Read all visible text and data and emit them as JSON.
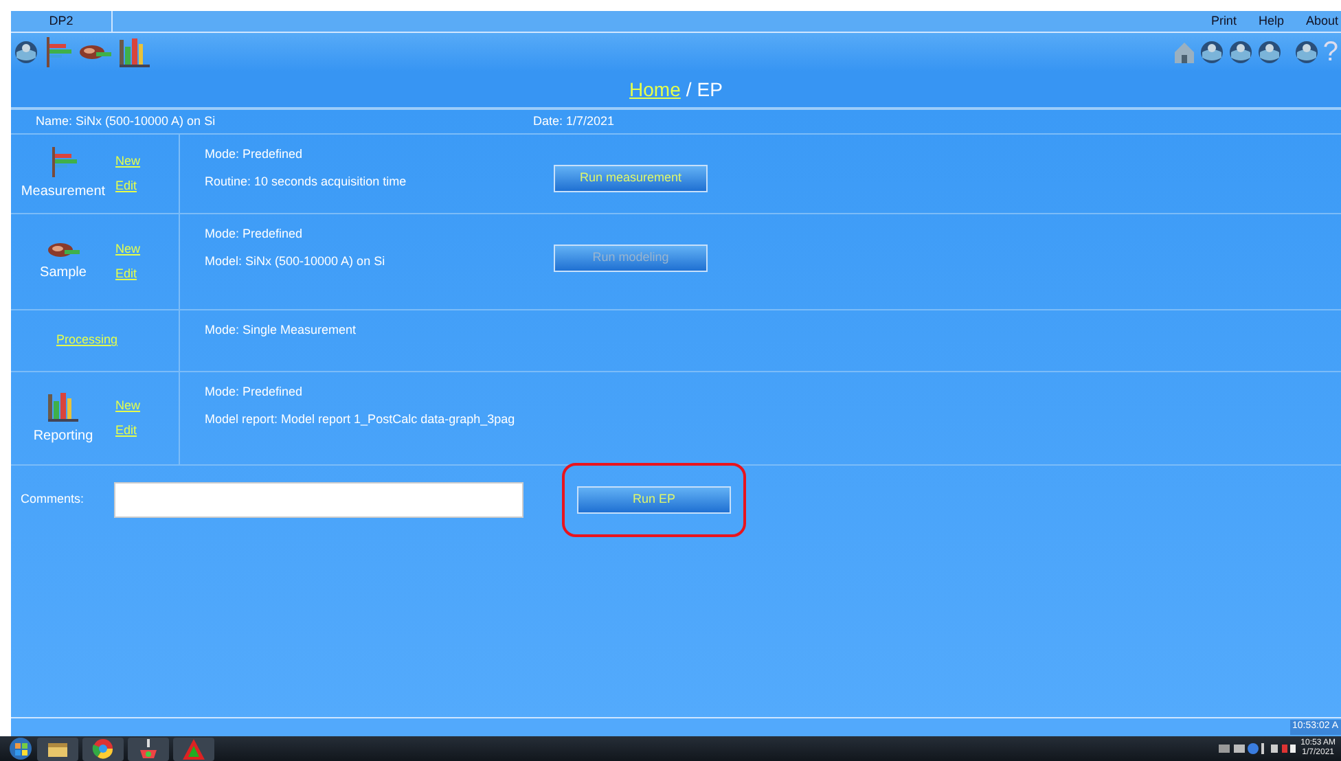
{
  "title_bar": {
    "title": "DP2",
    "menu": [
      "Print",
      "Help",
      "About"
    ]
  },
  "toolbar": {
    "help_glyph": "?"
  },
  "breadcrumb": {
    "link": "Home",
    "separator": "/",
    "current": "EP"
  },
  "header": {
    "name": "Name: SiNx (500-10000 A) on Si",
    "date": "Date: 1/7/2021"
  },
  "sections": [
    {
      "kind": "icon",
      "label": "Measurement",
      "links": [
        "New",
        "Edit"
      ],
      "lines": [
        "Mode: Predefined",
        "Routine: 10 seconds acquisition time"
      ],
      "button": {
        "label": "Run measurement",
        "disabled": false
      }
    },
    {
      "kind": "icon",
      "label": "Sample",
      "links": [
        "New",
        "Edit"
      ],
      "lines": [
        "Mode: Predefined",
        "Model: SiNx (500-10000 A) on Si"
      ],
      "button": {
        "label": "Run modeling",
        "disabled": true
      }
    },
    {
      "kind": "link",
      "label": "Processing",
      "lines": [
        "Mode: Single Measurement"
      ]
    },
    {
      "kind": "icon",
      "label": "Reporting",
      "links": [
        "New",
        "Edit"
      ],
      "lines": [
        "Mode: Predefined",
        "Model report: Model report 1_PostCalc data-graph_3pag"
      ]
    }
  ],
  "comments": {
    "label": "Comments:"
  },
  "run_button": {
    "label": "Run EP",
    "highlighted": true
  },
  "status_bar": {
    "time": "10:53:02 A"
  },
  "taskbar": {
    "clock": "10:53 AM",
    "date": "1/7/2021"
  }
}
